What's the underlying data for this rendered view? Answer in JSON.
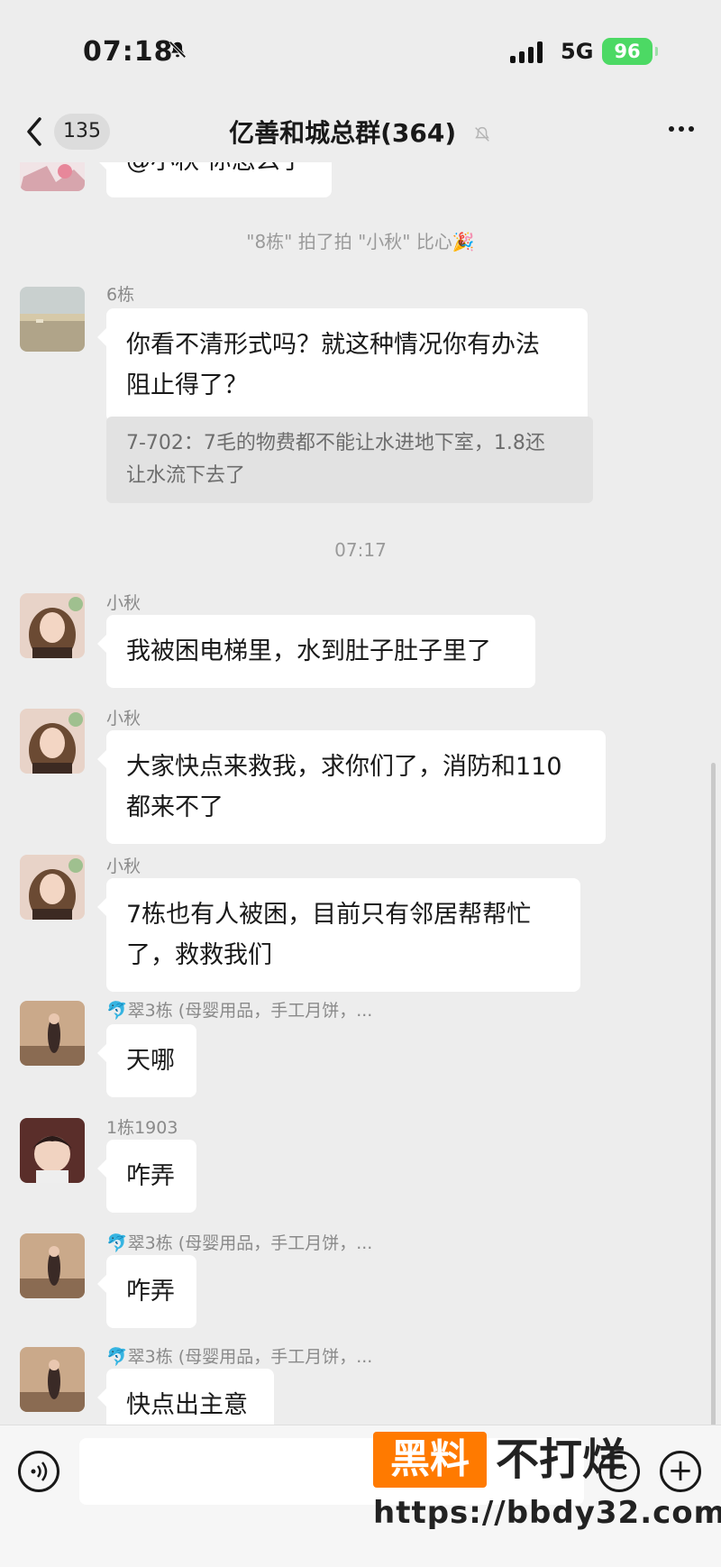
{
  "status_bar": {
    "time": "07:18",
    "network": "5G",
    "battery": "96"
  },
  "header": {
    "back_count": "135",
    "title": "亿善和城总群(364)"
  },
  "chat": {
    "top_partial_message": "@小秋 你怎么了",
    "system_tickle": "\"8栋\" 拍了拍 \"小秋\" 比心🎉",
    "timestamp": "07:17",
    "messages": [
      {
        "sender": "6栋",
        "text_line1": "你看不清形式吗？就这种情况你有办法",
        "text_line2": "阻止得了？",
        "quote_line1": "7-702：7毛的物费都不能让水进地下室，1.8还",
        "quote_line2": "让水流下去了"
      },
      {
        "sender": "小秋",
        "text_line1": "我被困电梯里，水到肚子肚子里了"
      },
      {
        "sender": "小秋",
        "text_line1": "大家快点来救我，求你们了，消防和110",
        "text_line2": "都来不了"
      },
      {
        "sender": "小秋",
        "text_line1": "7栋也有人被困，目前只有邻居帮帮忙",
        "text_line2": "了，救救我们"
      },
      {
        "sender": "🐬翠3栋 (母婴用品，手工月饼，...",
        "text_line1": "天哪"
      },
      {
        "sender": "1栋1903",
        "text_line1": "咋弄"
      },
      {
        "sender": "🐬翠3栋 (母婴用品，手工月饼，...",
        "text_line1": "咋弄"
      },
      {
        "sender": "🐬翠3栋 (母婴用品，手工月饼，...",
        "text_line1": "快点出主意"
      }
    ]
  },
  "watermark": {
    "badge": "黑料",
    "text": "不打烊",
    "url": "https://bbdy32.com"
  },
  "colors": {
    "background": "#ededed",
    "bubble": "#ffffff",
    "battery": "#4cd964",
    "watermark_orange": "#ff7a00"
  }
}
